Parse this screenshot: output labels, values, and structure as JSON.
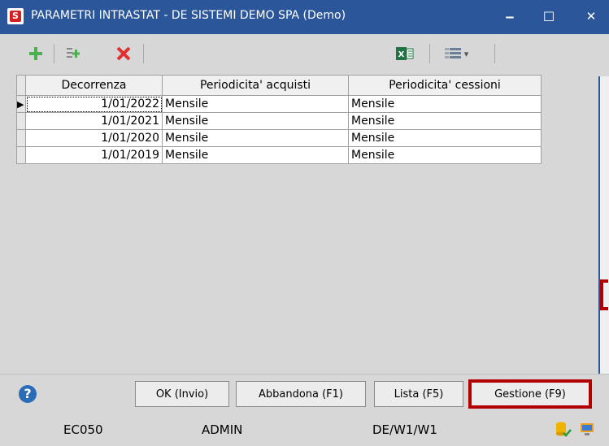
{
  "window": {
    "title": "PARAMETRI INTRASTAT - DE SISTEMI DEMO SPA  (Demo)",
    "minimize_glyph": "‒",
    "maximize_glyph": "☐",
    "close_glyph": "✕"
  },
  "toolbar": {
    "icons": [
      "add-icon",
      "insert-row-icon",
      "delete-icon",
      "excel-icon",
      "grid-settings-icon"
    ],
    "dropdown_glyph": "▾"
  },
  "grid": {
    "columns": [
      "Decorrenza",
      "Periodicita' acquisti",
      "Periodicita' cessioni"
    ],
    "rows": [
      {
        "decorrenza": "1/01/2022",
        "acquisti": "Mensile",
        "cessioni": "Mensile"
      },
      {
        "decorrenza": "1/01/2021",
        "acquisti": "Mensile",
        "cessioni": "Mensile"
      },
      {
        "decorrenza": "1/01/2020",
        "acquisti": "Mensile",
        "cessioni": "Mensile"
      },
      {
        "decorrenza": "1/01/2019",
        "acquisti": "Mensile",
        "cessioni": "Mensile"
      }
    ],
    "current_row_indicator": "▶"
  },
  "buttons": {
    "help_glyph": "?",
    "ok": "OK (Invio)",
    "abbandona": "Abbandona (F1)",
    "lista": "Lista (F5)",
    "gestione": "Gestione (F9)"
  },
  "statusbar": {
    "code": "EC050",
    "user": "ADMIN",
    "path": "DE/W1/W1"
  },
  "colors": {
    "titlebar": "#2b579a",
    "highlight": "#b20000",
    "add_green": "#4caf50",
    "delete_red": "#e03030"
  }
}
